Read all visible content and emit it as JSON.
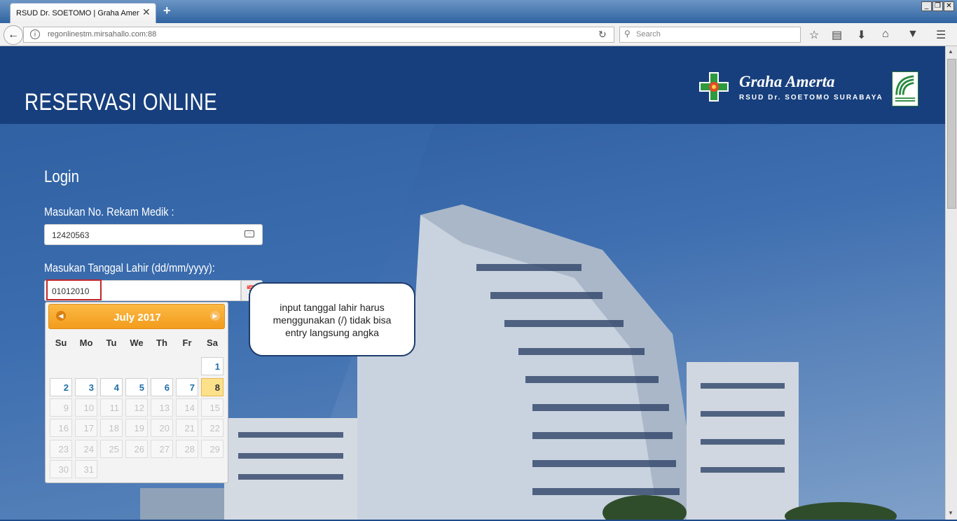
{
  "browser": {
    "tab_title": "RSUD Dr. SOETOMO | Graha Amerta",
    "tab_close": "✕",
    "new_tab": "+",
    "url": "regonlinestm.mirsahallo.com:88",
    "search_placeholder": "Search",
    "window_buttons": [
      "_",
      "❐",
      "✕"
    ],
    "toolbar_icons": [
      "star-icon",
      "reading-list-icon",
      "download-icon",
      "home-icon",
      "pocket-icon",
      "menu-icon"
    ]
  },
  "header": {
    "title": "RESERVASI ONLINE",
    "logo_name": "Graha Amerta",
    "logo_sub": "RSUD Dr. SOETOMO SURABAYA"
  },
  "login": {
    "title": "Login",
    "rm_label": "Masukan No. Rekam Medik :",
    "rm_value": "12420563",
    "dob_label": "Masukan Tanggal Lahir (dd/mm/yyyy):",
    "dob_value": "01012010"
  },
  "callout": {
    "text": "input tanggal lahir harus menggunakan (/) tidak bisa entry langsung angka"
  },
  "datepicker": {
    "title": "July 2017",
    "days_of_week": [
      "Su",
      "Mo",
      "Tu",
      "We",
      "Th",
      "Fr",
      "Sa"
    ],
    "weeks": [
      [
        "",
        "",
        "",
        "",
        "",
        "",
        "1"
      ],
      [
        "2",
        "3",
        "4",
        "5",
        "6",
        "7",
        "8"
      ],
      [
        "9",
        "10",
        "11",
        "12",
        "13",
        "14",
        "15"
      ],
      [
        "16",
        "17",
        "18",
        "19",
        "20",
        "21",
        "22"
      ],
      [
        "23",
        "24",
        "25",
        "26",
        "27",
        "28",
        "29"
      ],
      [
        "30",
        "31",
        "",
        "",
        "",
        "",
        ""
      ]
    ],
    "today": "8",
    "enabled_days": [
      "1",
      "2",
      "3",
      "4",
      "5",
      "6",
      "7"
    ]
  },
  "colors": {
    "header_bg": "#173f7d",
    "datepicker_header": "#f7a829",
    "today_bg": "#fde18a",
    "highlight_border": "#c0272d"
  }
}
